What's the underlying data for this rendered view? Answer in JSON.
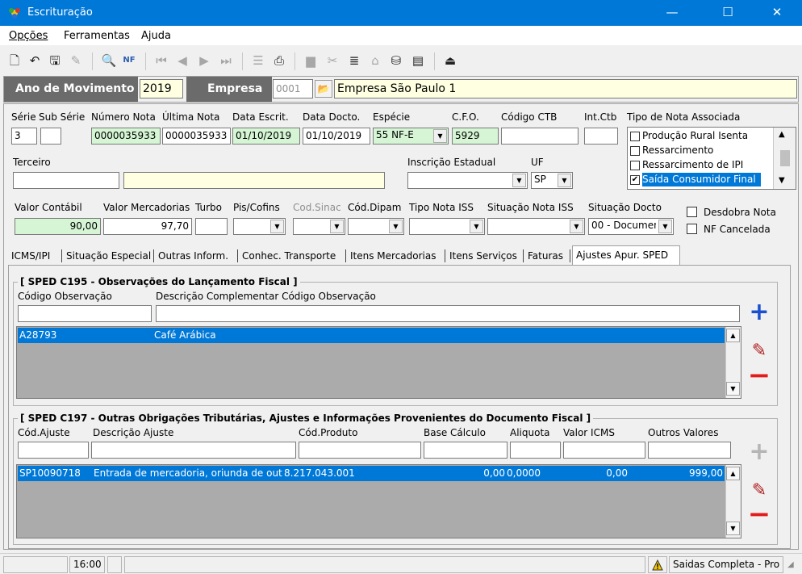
{
  "window": {
    "title": "Escrituração",
    "minimize": "—",
    "maximize": "☐",
    "close": "✕"
  },
  "menu": [
    "Opções",
    "Ferramentas",
    "Ajuda"
  ],
  "header": {
    "ano_label": "Ano de Movimento",
    "ano_value": "2019",
    "empresa_label": "Empresa",
    "empresa_code": "0001",
    "empresa_name": "Empresa São Paulo  1"
  },
  "labels": {
    "serie": "Série",
    "sub_serie": "Sub Série",
    "numero_nota": "Número Nota",
    "ultima_nota": "Última Nota",
    "data_escrit": "Data Escrit.",
    "data_docto": "Data Docto.",
    "especie": "Espécie",
    "cfo": "C.F.O.",
    "codigo_ctb": "Código CTB",
    "int_ctb": "Int.Ctb",
    "tipo_nota_assoc": "Tipo de Nota Associada",
    "terceiro": "Terceiro",
    "inscricao_estadual": "Inscrição Estadual",
    "uf": "UF",
    "valor_contabil": "Valor Contábil",
    "valor_mercadorias": "Valor Mercadorias",
    "turbo": "Turbo",
    "pis_cofins": "Pis/Cofins",
    "cod_sinac": "Cod.Sinac",
    "cod_dipam": "Cód.Dipam",
    "tipo_nota_iss": "Tipo Nota ISS",
    "situacao_nota_iss": "Situação Nota ISS",
    "situacao_docto": "Situação Docto",
    "desdobra_nota": "Desdobra Nota",
    "nf_cancelada": "NF Cancelada"
  },
  "values": {
    "serie": "3",
    "sub_serie": "",
    "numero_nota": "0000035933",
    "ultima_nota": "0000035933",
    "data_escrit": "01/10/2019",
    "data_docto": "01/10/2019",
    "especie": "55  NF-E",
    "cfo": "5929",
    "codigo_ctb": "",
    "int_ctb": "",
    "terceiro": "",
    "terceiro_name": "",
    "inscricao_estadual": "",
    "uf": "SP",
    "valor_contabil": "90,00",
    "valor_mercadorias": "97,70",
    "turbo": "",
    "situacao_docto": "00 - Documen"
  },
  "tipo_nota_list": [
    {
      "label": "Produção Rural Isenta",
      "checked": false,
      "selected": false
    },
    {
      "label": "Ressarcimento",
      "checked": false,
      "selected": false
    },
    {
      "label": "Ressarcimento de IPI",
      "checked": false,
      "selected": false
    },
    {
      "label": "Saída Consumidor Final",
      "checked": true,
      "selected": true
    }
  ],
  "tabs": [
    "ICMS/IPI",
    "Situação Especial",
    "Outras Inform.",
    "Conhec. Transporte",
    "Itens Mercadorias",
    "Itens Serviços",
    "Faturas",
    "Ajustes Apur. SPED"
  ],
  "c195": {
    "title": "[ SPED C195 - Observações do Lançamento Fiscal ]",
    "col_codigo": "Código Observação",
    "col_descricao": "Descrição Complementar Código Observação",
    "rows": [
      {
        "codigo": "A28793",
        "descricao": "Café Arábica"
      }
    ]
  },
  "c197": {
    "title": "[ SPED C197 - Outras Obrigações Tributárias, Ajustes e Informações Provenientes do Documento Fiscal  ]",
    "columns": [
      "Cód.Ajuste",
      "Descrição Ajuste",
      "Cód.Produto",
      "Base Cálculo",
      "Aliquota",
      "Valor ICMS",
      "Outros Valores"
    ],
    "rows": [
      {
        "cod_ajuste": "SP10090718",
        "descricao": "Entrada de mercadoria, oriunda de outra",
        "cod_produto": "8.217.043.001",
        "base": "0,00",
        "aliquota": "0,0000",
        "valor_icms": "0,00",
        "outros": "999,00"
      }
    ]
  },
  "status": {
    "time": "16:00",
    "mode": "Saidas Completa - Pro"
  },
  "colors": {
    "titlebar": "#0078d7",
    "selection": "#0078d7",
    "field_green": "#d5f5d5",
    "field_yellow": "#ffffe1",
    "add_blue": "#1a4fcf",
    "remove_red": "#e31b1b"
  }
}
